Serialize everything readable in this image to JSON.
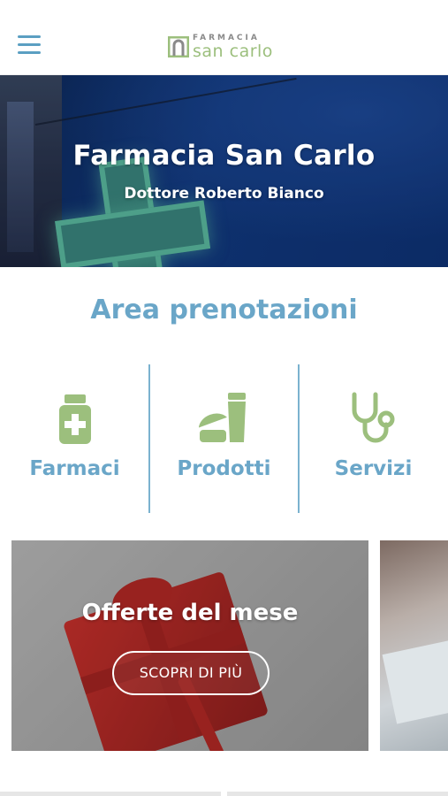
{
  "header": {
    "menu_icon": "hamburger-menu-icon",
    "logo": {
      "top_text": "FARMACIA",
      "main_text": "san carlo",
      "color_accent": "#9cbf7d"
    }
  },
  "hero": {
    "title": "Farmacia San Carlo",
    "subtitle": "Dottore Roberto Bianco"
  },
  "booking": {
    "title": "Area prenotazioni",
    "categories": [
      {
        "label": "Farmaci",
        "icon": "medicine-bottle-icon"
      },
      {
        "label": "Prodotti",
        "icon": "cosmetic-products-icon"
      },
      {
        "label": "Servizi",
        "icon": "stethoscope-icon"
      }
    ]
  },
  "offers_card": {
    "title": "Offerte del mese",
    "button_label": "SCOPRI DI PIÙ"
  },
  "colors": {
    "primary_blue": "#6aa6c8",
    "icon_green": "#9cbf7d",
    "hero_blue": "#123c86"
  }
}
